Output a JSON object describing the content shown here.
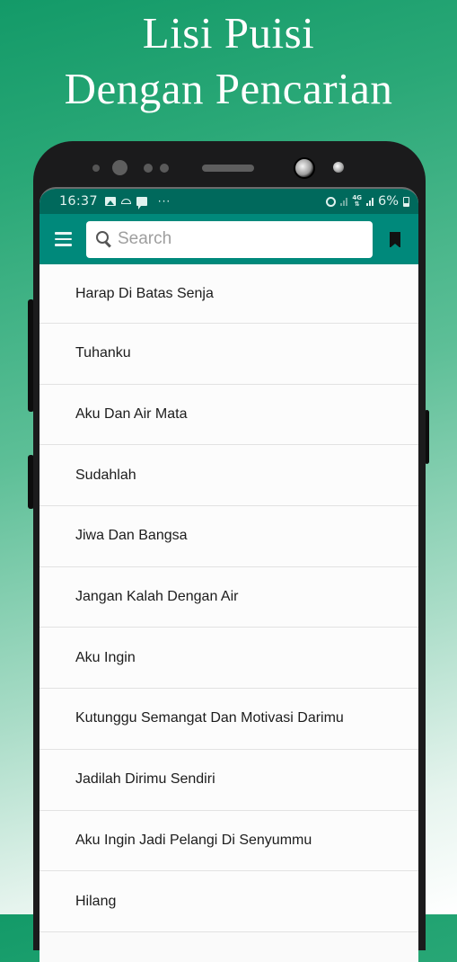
{
  "promo": {
    "title_line1": "Lisi Puisi",
    "title_line2": "Dengan Pencarian"
  },
  "status_bar": {
    "time": "16:37",
    "left_icons": [
      "gallery-icon",
      "dome-icon",
      "message-icon",
      "more-dots-icon"
    ],
    "more_dots": "···",
    "right_icons": [
      "alarm-icon",
      "signal-icon",
      "network-4g-icon",
      "signal-icon",
      "battery-icon"
    ],
    "network_label": "4G",
    "battery_percent": "6%"
  },
  "toolbar": {
    "menu_icon": "hamburger-menu-icon",
    "search": {
      "placeholder": "Search",
      "value": ""
    },
    "bookmark_icon": "bookmark-icon"
  },
  "colors": {
    "status_bar": "#00695c",
    "toolbar": "#00897b",
    "list_background": "#fcfcfc",
    "divider": "#e2e2e2",
    "phone_frame": "#1b1b1c"
  },
  "poems": [
    {
      "title": "Harap Di Batas Senja"
    },
    {
      "title": "Tuhanku"
    },
    {
      "title": "Aku Dan Air Mata"
    },
    {
      "title": "Sudahlah"
    },
    {
      "title": "Jiwa Dan Bangsa"
    },
    {
      "title": "Jangan Kalah Dengan Air"
    },
    {
      "title": "Aku Ingin"
    },
    {
      "title": "Kutunggu Semangat Dan Motivasi Darimu"
    },
    {
      "title": "Jadilah Dirimu Sendiri"
    },
    {
      "title": "Aku Ingin Jadi Pelangi Di Senyummu"
    },
    {
      "title": "Hilang"
    }
  ]
}
